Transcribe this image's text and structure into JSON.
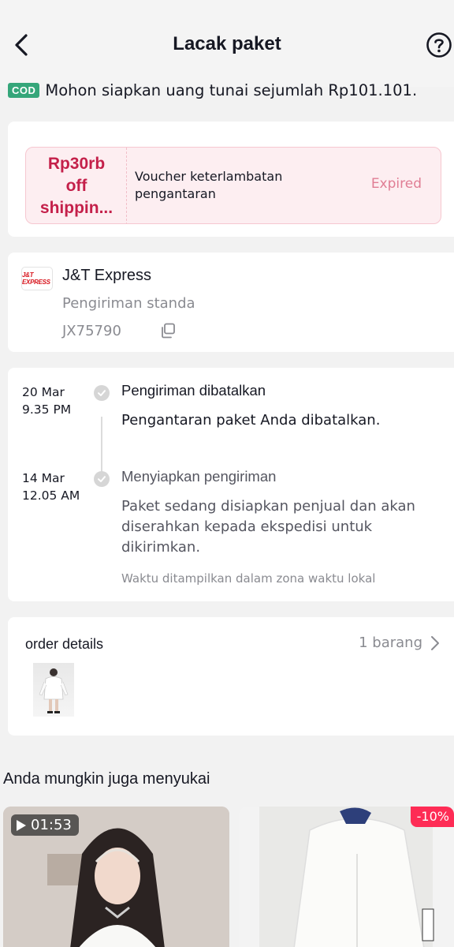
{
  "header": {
    "title": "Lacak paket",
    "back_icon": "chevron-left-icon",
    "help_icon": "question-circle-icon"
  },
  "cod": {
    "badge": "COD",
    "message": "Mohon siapkan uang tunai sejumlah Rp101.101."
  },
  "voucher": {
    "amount_lines": [
      "Rp30rb",
      "off",
      "shippin..."
    ],
    "description": "Voucher keterlambatan pengantaran",
    "status": "Expired"
  },
  "courier": {
    "logo_text": "J&T EXPRESS",
    "name": "J&T Express",
    "service": "Pengiriman standa",
    "tracking_number": "JX75790",
    "copy_icon": "copy-icon"
  },
  "tracking": {
    "events": [
      {
        "date": "20 Mar",
        "time": "9.35 PM",
        "title": "Pengiriman dibatalkan",
        "description": "Pengantaran paket Anda dibatalkan."
      },
      {
        "date": "14 Mar",
        "time": "12.05 AM",
        "title": "Menyiapkan pengiriman",
        "description": "Paket sedang disiapkan penjual dan akan diserahkan kepada ekspedisi untuk dikirimkan."
      }
    ],
    "timezone_note": "Waktu ditampilkan dalam zona waktu lokal"
  },
  "order": {
    "title": "order details",
    "count": "1 barang"
  },
  "recommendations": {
    "title": "Anda mungkin juga menyukai",
    "items": [
      {
        "video_duration": "01:53"
      },
      {
        "discount": "-10%"
      }
    ]
  },
  "colors": {
    "cod_green": "#35a67a",
    "voucher_red": "#c4204a",
    "expired_pink": "#e07d94",
    "discount_red": "#fe2c55"
  }
}
